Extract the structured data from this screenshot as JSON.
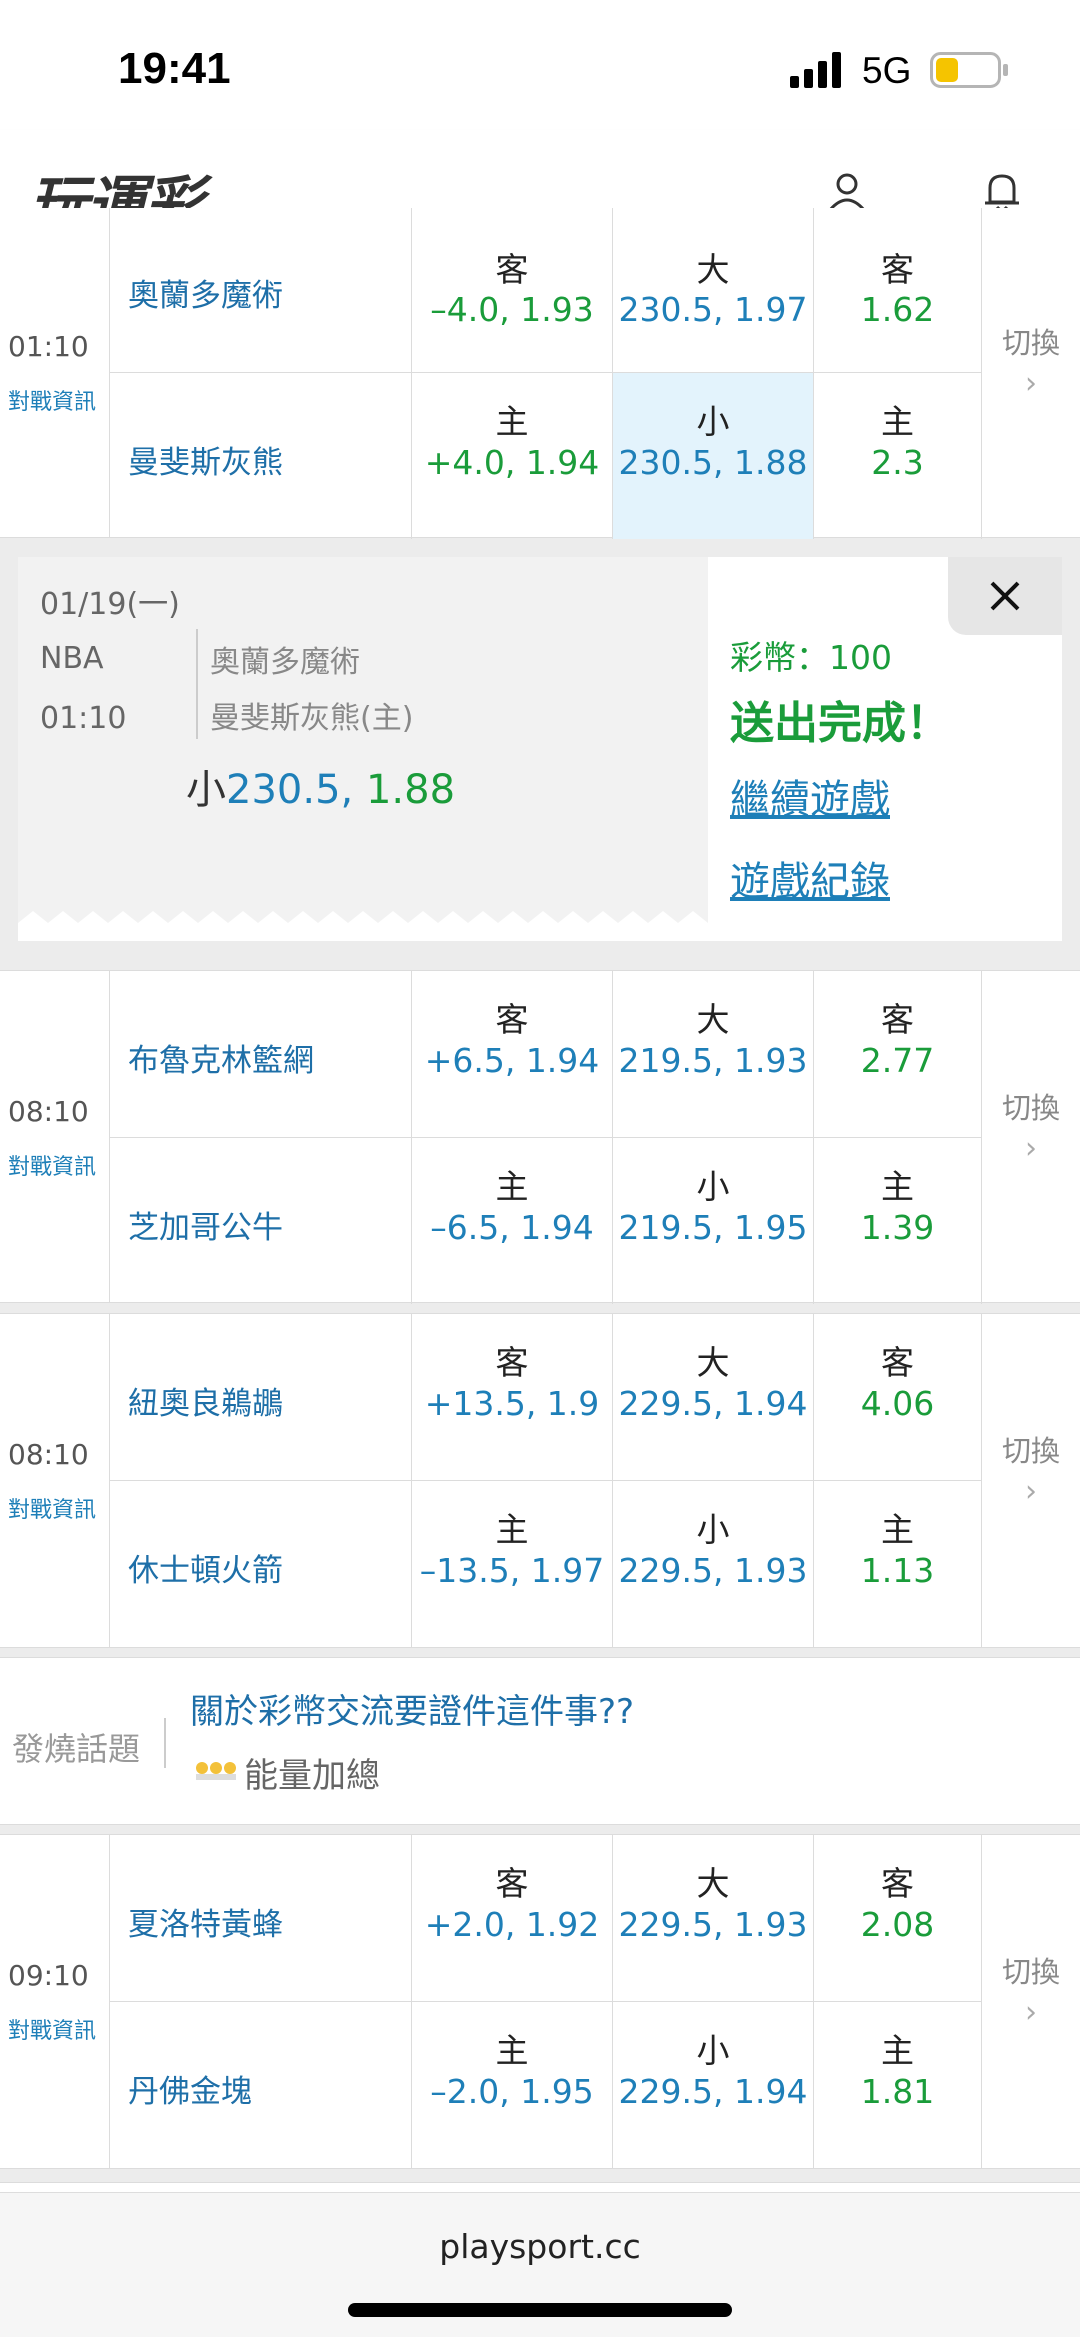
{
  "status": {
    "time": "19:41",
    "network": "5G"
  },
  "header": {
    "logo": "玩運彩"
  },
  "games": [
    {
      "time": "01:10",
      "info": "對戰資訊",
      "away": {
        "name": "奧蘭多魔術",
        "spread_label": "客",
        "spread": "–4.0, 1.93",
        "total_label": "大",
        "total": "230.5, 1.97",
        "ml_label": "客",
        "ml": "1.62"
      },
      "home": {
        "name": "曼斐斯灰熊",
        "spread_label": "主",
        "spread": "+4.0, 1.94",
        "total_label": "小",
        "total": "230.5, 1.88",
        "ml_label": "主",
        "ml": "2.3"
      },
      "switch": "切換"
    },
    {
      "time": "08:10",
      "info": "對戰資訊",
      "away": {
        "name": "布魯克林籃網",
        "spread_label": "客",
        "spread": "+6.5, 1.94",
        "total_label": "大",
        "total": "219.5, 1.93",
        "ml_label": "客",
        "ml": "2.77"
      },
      "home": {
        "name": "芝加哥公牛",
        "spread_label": "主",
        "spread": "–6.5, 1.94",
        "total_label": "小",
        "total": "219.5, 1.95",
        "ml_label": "主",
        "ml": "1.39"
      },
      "switch": "切換"
    },
    {
      "time": "08:10",
      "info": "對戰資訊",
      "away": {
        "name": "紐奧良鵜鶘",
        "spread_label": "客",
        "spread": "+13.5, 1.9",
        "total_label": "大",
        "total": "229.5, 1.94",
        "ml_label": "客",
        "ml": "4.06"
      },
      "home": {
        "name": "休士頓火箭",
        "spread_label": "主",
        "spread": "–13.5, 1.97",
        "total_label": "小",
        "total": "229.5, 1.93",
        "ml_label": "主",
        "ml": "1.13"
      },
      "switch": "切換"
    },
    {
      "time": "09:10",
      "info": "對戰資訊",
      "away": {
        "name": "夏洛特黃蜂",
        "spread_label": "客",
        "spread": "+2.0, 1.92",
        "total_label": "大",
        "total": "229.5, 1.93",
        "ml_label": "客",
        "ml": "2.08"
      },
      "home": {
        "name": "丹佛金塊",
        "spread_label": "主",
        "spread": "–2.0, 1.95",
        "total_label": "小",
        "total": "229.5, 1.94",
        "ml_label": "主",
        "ml": "1.81"
      },
      "switch": "切換"
    }
  ],
  "popup": {
    "date": "01/19(一)",
    "league": "NBA",
    "time": "01:10",
    "team1": "奧蘭多魔術",
    "team2": "曼斐斯灰熊(主)",
    "bet_side": "小",
    "bet_line": "230.5,",
    "bet_odds": "1.88",
    "coins": "彩幣：100",
    "done": "送出完成！",
    "continue_link": "繼續遊戲",
    "record_link": "遊戲紀錄"
  },
  "forum": {
    "label": "發燒話題",
    "title": "關於彩幣交流要證件這件事??",
    "user": "能量加總"
  },
  "footer": {
    "url": "playsport.cc"
  }
}
